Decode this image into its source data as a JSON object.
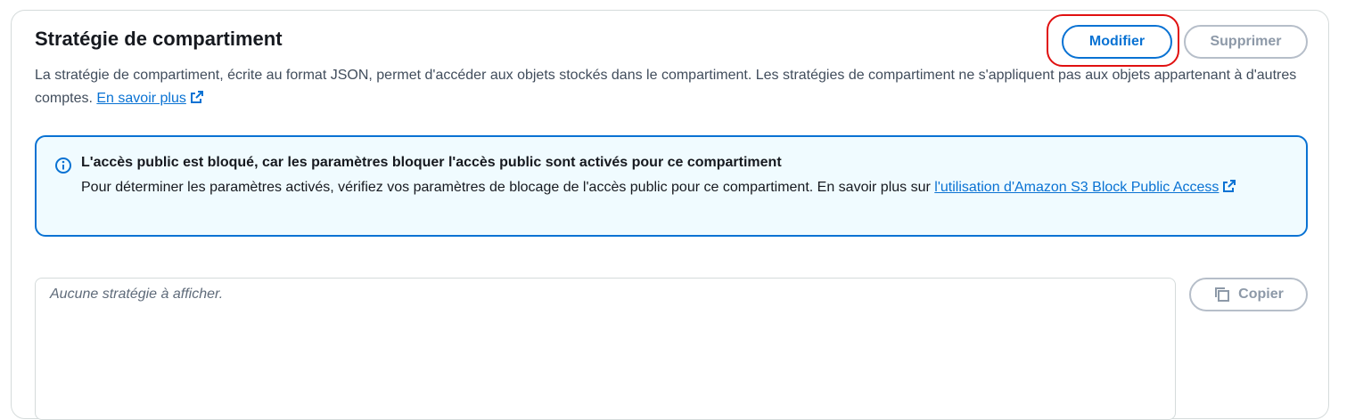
{
  "section": {
    "title": "Stratégie de compartiment",
    "description": "La stratégie de compartiment, écrite au format JSON, permet d'accéder aux objets stockés dans le compartiment. Les stratégies de compartiment ne s'appliquent pas aux objets appartenant à d'autres comptes.",
    "learn_more": "En savoir plus"
  },
  "actions": {
    "edit_label": "Modifier",
    "delete_label": "Supprimer",
    "copy_label": "Copier"
  },
  "alert": {
    "title": "L'accès public est bloqué, car les paramètres bloquer l'accès public sont activés pour ce compartiment",
    "body": "Pour déterminer les paramètres activés, vérifiez vos paramètres de blocage de l'accès public pour ce compartiment. En savoir plus sur",
    "link": "l'utilisation d'Amazon S3 Block Public Access"
  },
  "editor": {
    "placeholder": "Aucune stratégie à afficher."
  },
  "icons": {
    "info": "info-icon",
    "external": "external-link-icon",
    "copy": "copy-icon"
  },
  "colors": {
    "primary": "#0972d3",
    "disabled": "#8d99a8",
    "alert_bg": "#f0fbff",
    "annotation": "#e01010"
  }
}
